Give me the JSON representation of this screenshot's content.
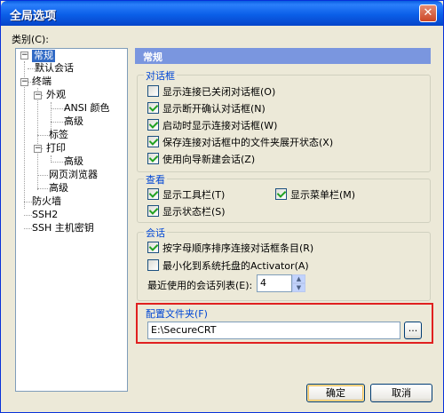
{
  "window": {
    "title": "全局选项",
    "close_glyph": "✕"
  },
  "category_label": "类别(C):",
  "tree": {
    "items": [
      {
        "label": "常规"
      },
      {
        "label": "默认会话"
      },
      {
        "label": "终端"
      },
      {
        "label": "外观"
      },
      {
        "label": "ANSI 颜色"
      },
      {
        "label": "高级"
      },
      {
        "label": "标签"
      },
      {
        "label": "打印"
      },
      {
        "label": "高级"
      },
      {
        "label": "网页浏览器"
      },
      {
        "label": "高级"
      },
      {
        "label": "防火墙"
      },
      {
        "label": "SSH2"
      },
      {
        "label": "SSH 主机密钥"
      }
    ],
    "expander_minus": "−"
  },
  "panel": {
    "header": "常规",
    "dialogs_group": {
      "title": "对话框",
      "items": [
        {
          "label": "显示连接已关闭对话框(O)",
          "checked": false
        },
        {
          "label": "显示断开确认对话框(N)",
          "checked": true
        },
        {
          "label": "启动时显示连接对话框(W)",
          "checked": true
        },
        {
          "label": "保存连接对话框中的文件夹展开状态(X)",
          "checked": true
        },
        {
          "label": "使用向导新建会话(Z)",
          "checked": true
        }
      ]
    },
    "view_group": {
      "title": "查看",
      "items": [
        {
          "label": "显示工具栏(T)",
          "checked": true
        },
        {
          "label": "显示菜单栏(M)",
          "checked": true
        },
        {
          "label": "显示状态栏(S)",
          "checked": true
        }
      ]
    },
    "session_group": {
      "title": "会话",
      "items": [
        {
          "label": "按字母顺序排序连接对话框条目(R)",
          "checked": true
        },
        {
          "label": "最小化到系统托盘的Activator(A)",
          "checked": false
        }
      ],
      "recent_label": "最近使用的会话列表(E):",
      "recent_value": "4"
    },
    "config_group": {
      "title": "配置文件夹(F)",
      "path_value": "E:\\SecureCRT",
      "browse_label": "..."
    }
  },
  "buttons": {
    "ok": "确定",
    "cancel": "取消"
  }
}
